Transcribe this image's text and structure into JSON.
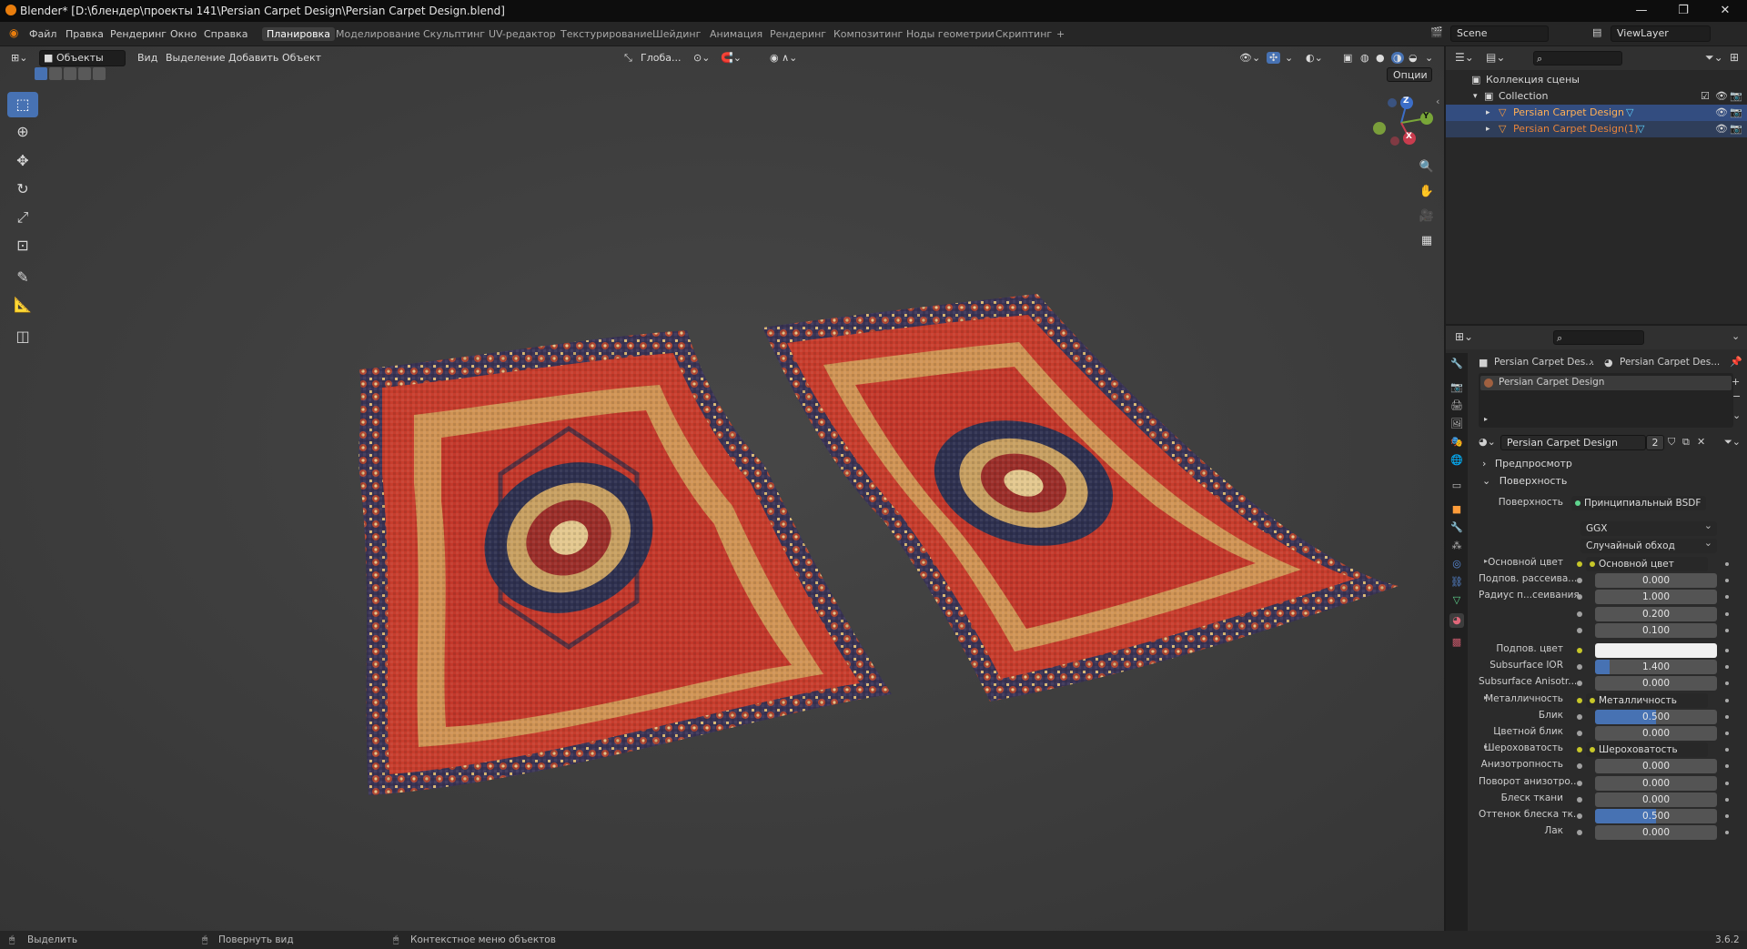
{
  "titlebar": {
    "title": "Blender* [D:\\блендер\\проекты 141\\Persian Carpet Design\\Persian Carpet Design.blend]",
    "minimize": "—",
    "maximize": "❐",
    "close": "✕"
  },
  "menubar": {
    "menus": [
      "Файл",
      "Правка",
      "Рендеринг",
      "Окно",
      "Справка"
    ],
    "workspaces": [
      "Планировка",
      "Моделирование",
      "Скульптинг",
      "UV-редактор",
      "Текстурирование",
      "Шейдинг",
      "Анимация",
      "Рендеринг",
      "Композитинг",
      "Ноды геометрии",
      "Скриптинг"
    ],
    "active_workspace": "Планировка",
    "add_tab": "+",
    "scene": "Scene",
    "view_layer": "ViewLayer"
  },
  "viewport": {
    "mode": "Объекты",
    "menus": [
      "Вид",
      "Выделение",
      "Добавить",
      "Объект"
    ],
    "orientation": "Глоба...",
    "options": "Опции",
    "gizmo": {
      "z": "Z",
      "y": "Y",
      "x": "X"
    }
  },
  "outliner": {
    "scene_collection": "Коллекция сцены",
    "collection": "Collection",
    "objects": [
      "Persian Carpet Design",
      "Persian Carpet Design(1)"
    ]
  },
  "properties": {
    "breadcrumb": [
      "Persian Carpet Des...",
      "Persian Carpet Des..."
    ],
    "material_slot": "Persian Carpet Design",
    "material_name": "Persian Carpet Design",
    "users": "2",
    "sections": {
      "preview": "Предпросмотр",
      "surface": "Поверхность"
    },
    "surface_label": "Поверхность",
    "surface_value": "Принципиальный BSDF",
    "distribution": "GGX",
    "subsurface_method": "Случайный обход",
    "rows": [
      {
        "label": "Основной цвет",
        "value": "Основной цвет",
        "kind": "link"
      },
      {
        "label": "Подпов. рассеива...",
        "value": "0.000",
        "kind": "num",
        "fill": 0
      },
      {
        "label": "Радиус п...сеивания",
        "value": "1.000",
        "kind": "num",
        "fill": 0
      },
      {
        "label": "",
        "value": "0.200",
        "kind": "num",
        "fill": 0
      },
      {
        "label": "",
        "value": "0.100",
        "kind": "num",
        "fill": 0
      },
      {
        "label": "Подпов. цвет",
        "value": "",
        "kind": "color"
      },
      {
        "label": "Subsurface IOR",
        "value": "1.400",
        "kind": "num",
        "fill": 0.12
      },
      {
        "label": "Subsurface Anisotr...",
        "value": "0.000",
        "kind": "num",
        "fill": 0
      },
      {
        "label": "Металличность",
        "value": "Металличность",
        "kind": "link"
      },
      {
        "label": "Блик",
        "value": "0.500",
        "kind": "num",
        "fill": 0.5
      },
      {
        "label": "Цветной блик",
        "value": "0.000",
        "kind": "num",
        "fill": 0
      },
      {
        "label": "Шероховатость",
        "value": "Шероховатость",
        "kind": "link"
      },
      {
        "label": "Анизотропность",
        "value": "0.000",
        "kind": "num",
        "fill": 0
      },
      {
        "label": "Поворот анизотро...",
        "value": "0.000",
        "kind": "num",
        "fill": 0
      },
      {
        "label": "Блеск ткани",
        "value": "0.000",
        "kind": "num",
        "fill": 0
      },
      {
        "label": "Оттенок блеска тк...",
        "value": "0.500",
        "kind": "num",
        "fill": 0.5
      },
      {
        "label": "Лак",
        "value": "0.000",
        "kind": "num",
        "fill": 0
      }
    ]
  },
  "statusbar": {
    "select": "Выделить",
    "rotate": "Повернуть вид",
    "context": "Контекстное меню объектов",
    "version": "3.6.2"
  },
  "colors": {
    "accent": "#4772b3",
    "viewport_bg": "#3d3d3d",
    "carpet_red": "#c2372a",
    "carpet_navy": "#2d2f4d",
    "carpet_cream": "#d8c08a"
  }
}
